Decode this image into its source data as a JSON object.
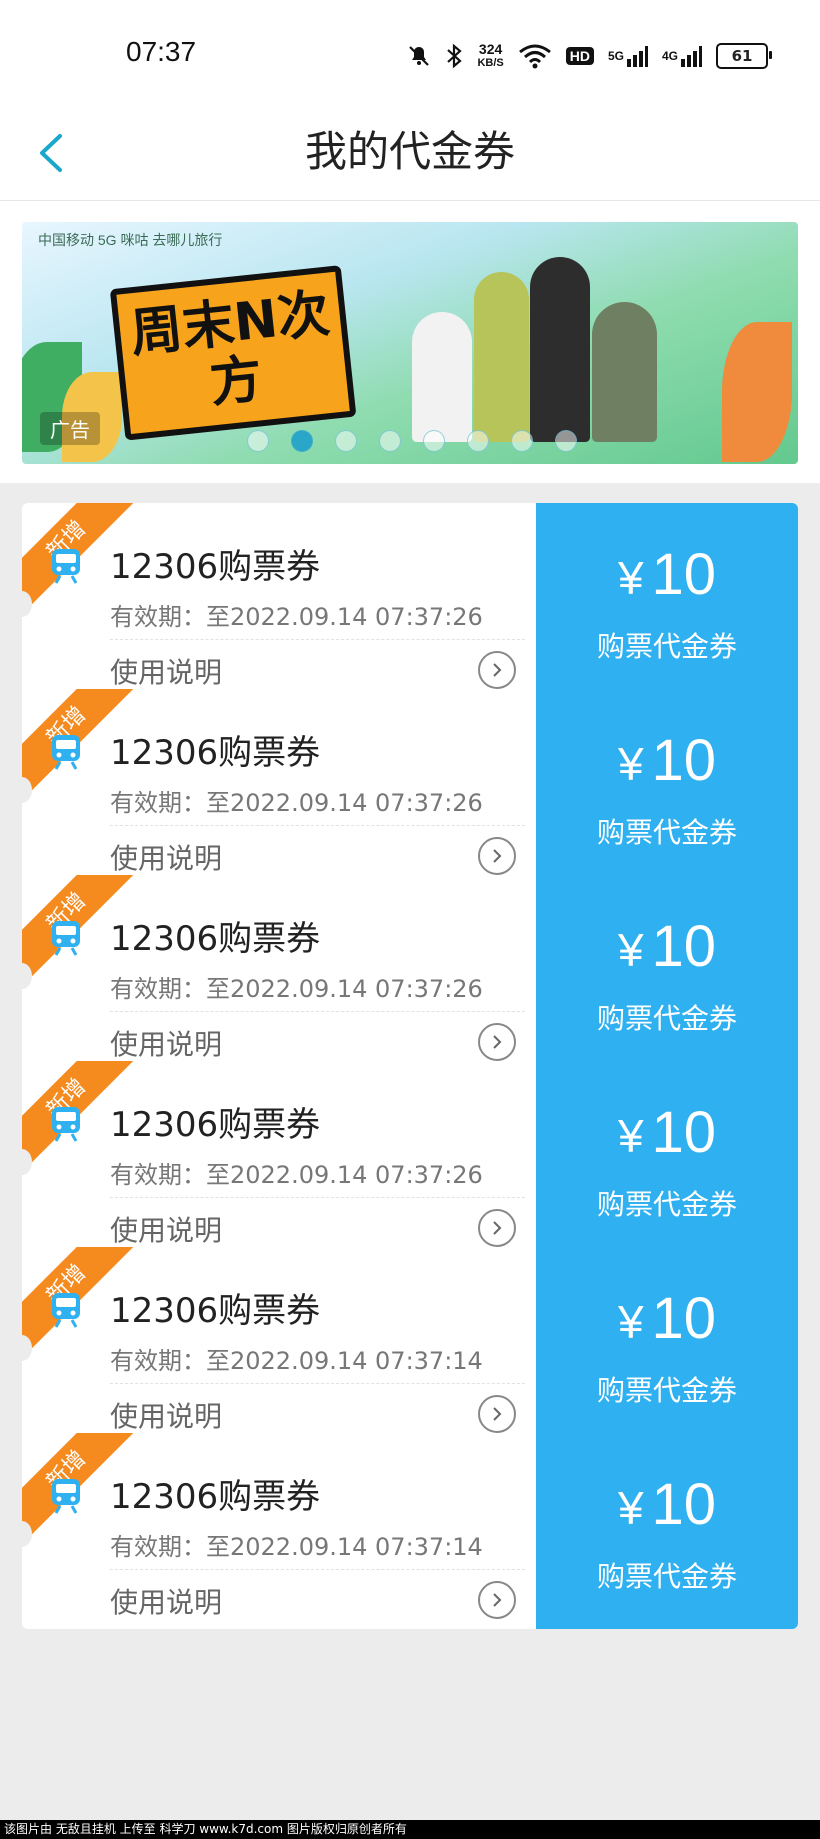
{
  "status_bar": {
    "time": "07:37",
    "net_speed_value": "324",
    "net_speed_unit": "KB/S",
    "hd_label": "HD",
    "signal1": "5G",
    "signal2": "4G",
    "battery": "61"
  },
  "header": {
    "title": "我的代金券"
  },
  "banner": {
    "sponsors": "中国移动  5G  咪咕  去哪儿旅行",
    "headline": "周末N次方",
    "ad_label": "广告",
    "slide_count": 8,
    "active_slide": 2
  },
  "coupons": [
    {
      "ribbon": "新增",
      "title": "12306购票券",
      "validity": "有效期：至2022.09.14 07:37:26",
      "help": "使用说明",
      "currency": "¥",
      "amount": "10",
      "type": "购票代金券"
    },
    {
      "ribbon": "新增",
      "title": "12306购票券",
      "validity": "有效期：至2022.09.14 07:37:26",
      "help": "使用说明",
      "currency": "¥",
      "amount": "10",
      "type": "购票代金券"
    },
    {
      "ribbon": "新增",
      "title": "12306购票券",
      "validity": "有效期：至2022.09.14 07:37:26",
      "help": "使用说明",
      "currency": "¥",
      "amount": "10",
      "type": "购票代金券"
    },
    {
      "ribbon": "新增",
      "title": "12306购票券",
      "validity": "有效期：至2022.09.14 07:37:26",
      "help": "使用说明",
      "currency": "¥",
      "amount": "10",
      "type": "购票代金券"
    },
    {
      "ribbon": "新增",
      "title": "12306购票券",
      "validity": "有效期：至2022.09.14 07:37:14",
      "help": "使用说明",
      "currency": "¥",
      "amount": "10",
      "type": "购票代金券"
    },
    {
      "ribbon": "新增",
      "title": "12306购票券",
      "validity": "有效期：至2022.09.14 07:37:14",
      "help": "使用说明",
      "currency": "¥",
      "amount": "10",
      "type": "购票代金券"
    }
  ],
  "watermark": "该图片由 无敌且挂机 上传至 科学刀 www.k7d.com 图片版权归原创者所有",
  "colors": {
    "accent": "#2fb0f0",
    "ribbon": "#f58a1f",
    "back_arrow": "#1aa7c9",
    "list_bg": "#ececec"
  }
}
